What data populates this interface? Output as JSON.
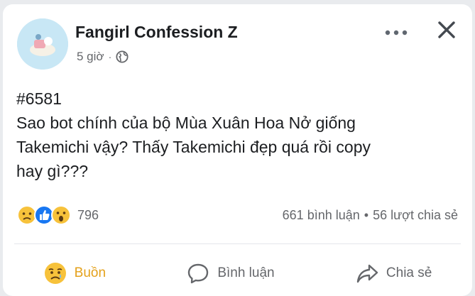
{
  "post": {
    "page_name": "Fangirl Confession Z",
    "time": "5 giờ",
    "dot": "·",
    "body_lines": [
      "#6581",
      "Sao bot chính của bộ Mùa Xuân Hoa Nở giống",
      "Takemichi vậy? Thấy Takemichi đẹp quá rồi copy",
      "hay gì???"
    ]
  },
  "stats": {
    "reactions": [
      "sad",
      "like",
      "wow"
    ],
    "reaction_count": "796",
    "comments": "661 bình luận",
    "separator": "•",
    "shares": "56 lượt chia sẻ"
  },
  "actions": {
    "react_label": "Buồn",
    "comment_label": "Bình luận",
    "share_label": "Chia sẻ"
  },
  "colors": {
    "sad_reaction": "#f7c23b",
    "like_reaction": "#1877f2",
    "active_reaction_text": "#e4a11b",
    "muted_text": "#65676b"
  }
}
